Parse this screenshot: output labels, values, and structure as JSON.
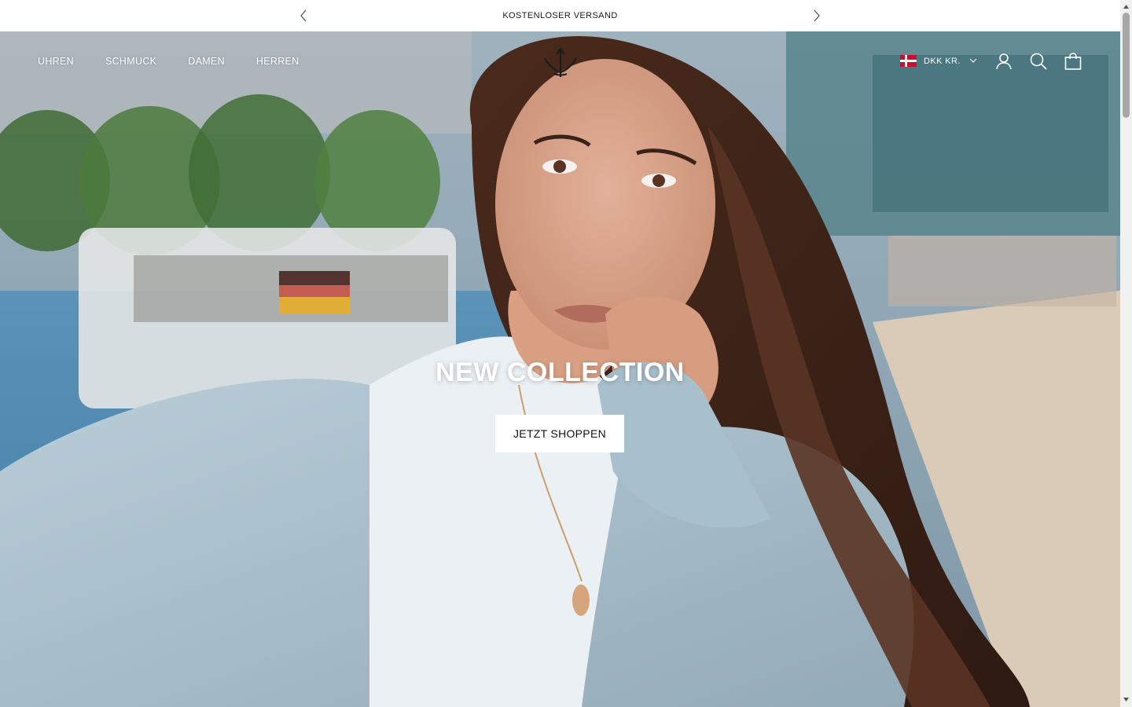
{
  "announcement": {
    "text": "KOSTENLOSER VERSAND",
    "prev_icon": "chevron-left-icon",
    "next_icon": "chevron-right-icon"
  },
  "nav": {
    "items": [
      {
        "label": "UHREN"
      },
      {
        "label": "SCHMUCK"
      },
      {
        "label": "DAMEN"
      },
      {
        "label": "HERREN"
      }
    ]
  },
  "header": {
    "logo_icon": "trident-logo-icon",
    "currency_label": "DKK KR.",
    "flag_icon": "denmark-flag-icon",
    "icons": [
      "user-icon",
      "search-icon",
      "shopping-bag-icon"
    ]
  },
  "hero": {
    "title": "NEW COLLECTION",
    "cta_label": "JETZT SHOPPEN"
  },
  "colors": {
    "accent": "#ffffff",
    "text_dark": "#1a1a1a",
    "flag_red": "#c8102e"
  }
}
